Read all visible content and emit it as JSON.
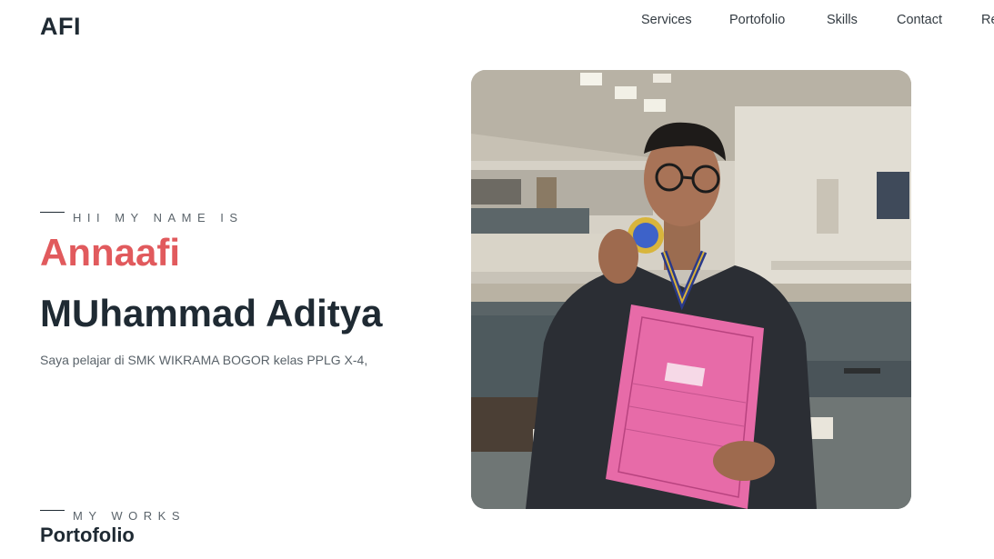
{
  "brand": {
    "logo": "AFI"
  },
  "nav": {
    "items": [
      "Services",
      "Portofolio",
      "Skills",
      "Contact",
      "Re"
    ]
  },
  "hero": {
    "eyebrow": "Hii my name is",
    "first_name": "Annaafi",
    "last_name": "MUhammad Aditya",
    "description": "Saya pelajar di SMK WIKRAMA BOGOR kelas PPLG X-4,",
    "photo": "profile-photo",
    "accent_color": "#e15a5d"
  },
  "works": {
    "eyebrow": "My works",
    "title": "Portofolio"
  }
}
